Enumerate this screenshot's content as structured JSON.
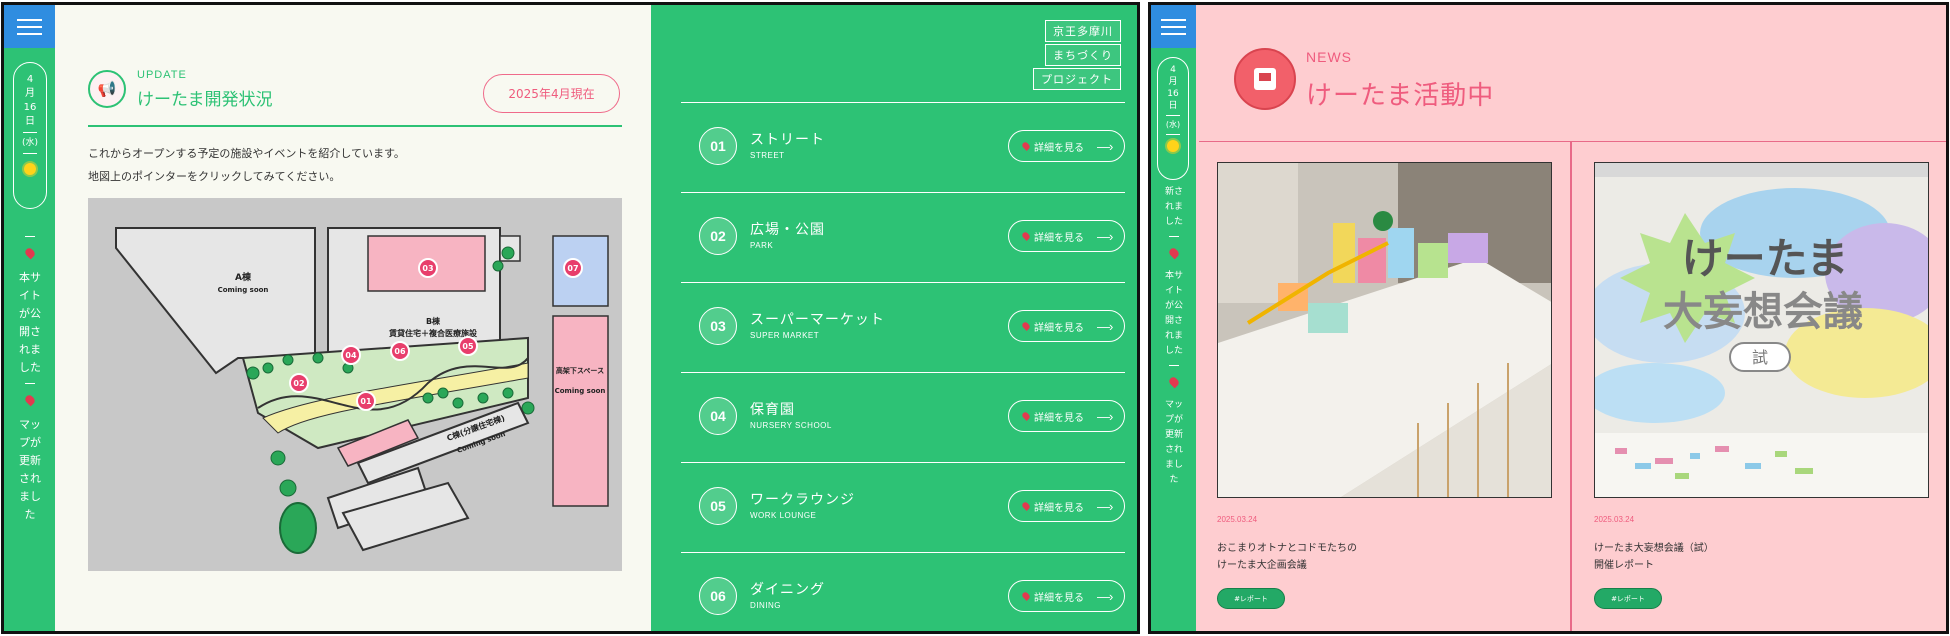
{
  "rail": {
    "date_month": "4",
    "month_unit": "月",
    "date_day": "16",
    "day_unit": "日",
    "weekday": "(水)",
    "ticker_items": [
      "本サイトが公開されました",
      "マップが更新されました"
    ],
    "ticker_items_short": [
      "新されました",
      "本サイトが公開されました",
      "マップが更新されました"
    ]
  },
  "update": {
    "kicker": "UPDATE",
    "title": "けーたま開発状況",
    "month_badge": "2025年4月現在",
    "desc_line1": "これからオープンする予定の施設やイベントを紹介しています。",
    "desc_line2": "地図上のポインターをクリックしてみてください。"
  },
  "map": {
    "a_block": "A棟",
    "a_status": "Coming soon",
    "b_block": "B棟",
    "b_desc": "賃貸住宅＋複合医療施設",
    "c_block": "C棟(分譲住宅棟)",
    "c_status": "Coming soon",
    "space_label": "高架下スペース",
    "space_status": "Coming soon",
    "markers": [
      "01",
      "02",
      "03",
      "04",
      "05",
      "06",
      "07"
    ]
  },
  "tags": [
    "京王多摩川",
    "まちづくり",
    "プロジェクト"
  ],
  "projects": [
    {
      "num": "01",
      "jp": "ストリート",
      "en": "STREET",
      "button": "詳細を見る"
    },
    {
      "num": "02",
      "jp": "広場・公園",
      "en": "PARK",
      "button": "詳細を見る"
    },
    {
      "num": "03",
      "jp": "スーパーマーケット",
      "en": "SUPER MARKET",
      "button": "詳細を見る"
    },
    {
      "num": "04",
      "jp": "保育園",
      "en": "NURSERY SCHOOL",
      "button": "詳細を見る"
    },
    {
      "num": "05",
      "jp": "ワークラウンジ",
      "en": "WORK LOUNGE",
      "button": "詳細を見る"
    },
    {
      "num": "06",
      "jp": "ダイニング",
      "en": "DINING",
      "button": "詳細を見る"
    }
  ],
  "news": {
    "kicker": "NEWS",
    "title": "けーたま活動中",
    "cards": [
      {
        "date": "2025.03.24",
        "title_line1": "おこまりオトナとコドモたちの",
        "title_line2": "けーたま大企画会議",
        "button": "#レポート"
      },
      {
        "date": "2025.03.24",
        "title_line1": "けーたま大妄想会議（試）",
        "title_line2": "開催レポート",
        "button": "#レポート",
        "image_text_1": "けーたま",
        "image_text_2": "大妄想会議",
        "image_text_3": "試"
      }
    ]
  },
  "colors": {
    "green": "#2dc275",
    "pink": "#fecdd0",
    "accent_pink": "#ef5c7e",
    "blue": "#2f8de0"
  }
}
